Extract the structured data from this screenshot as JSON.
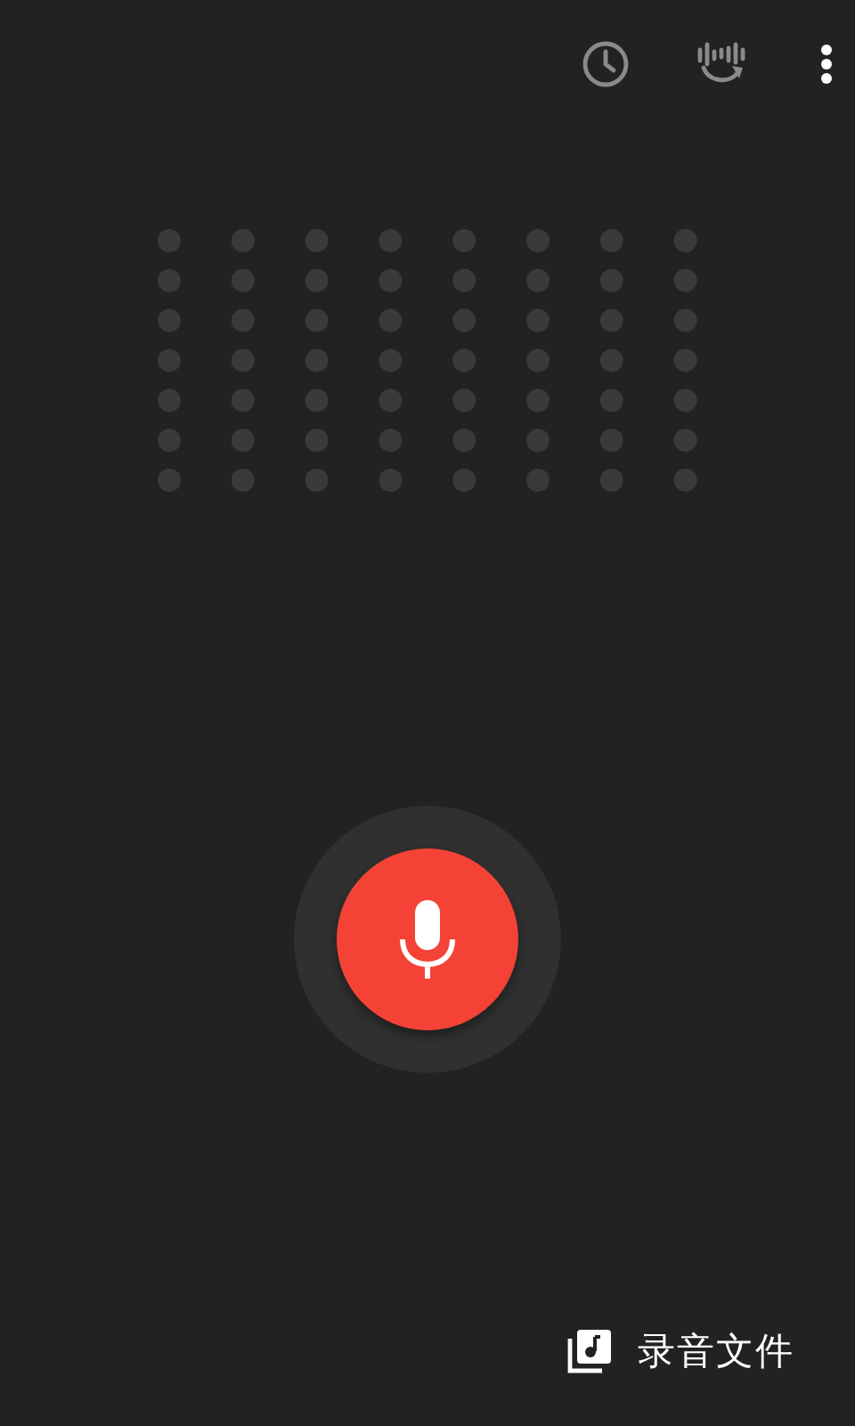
{
  "files_button": {
    "label": "录音文件"
  }
}
